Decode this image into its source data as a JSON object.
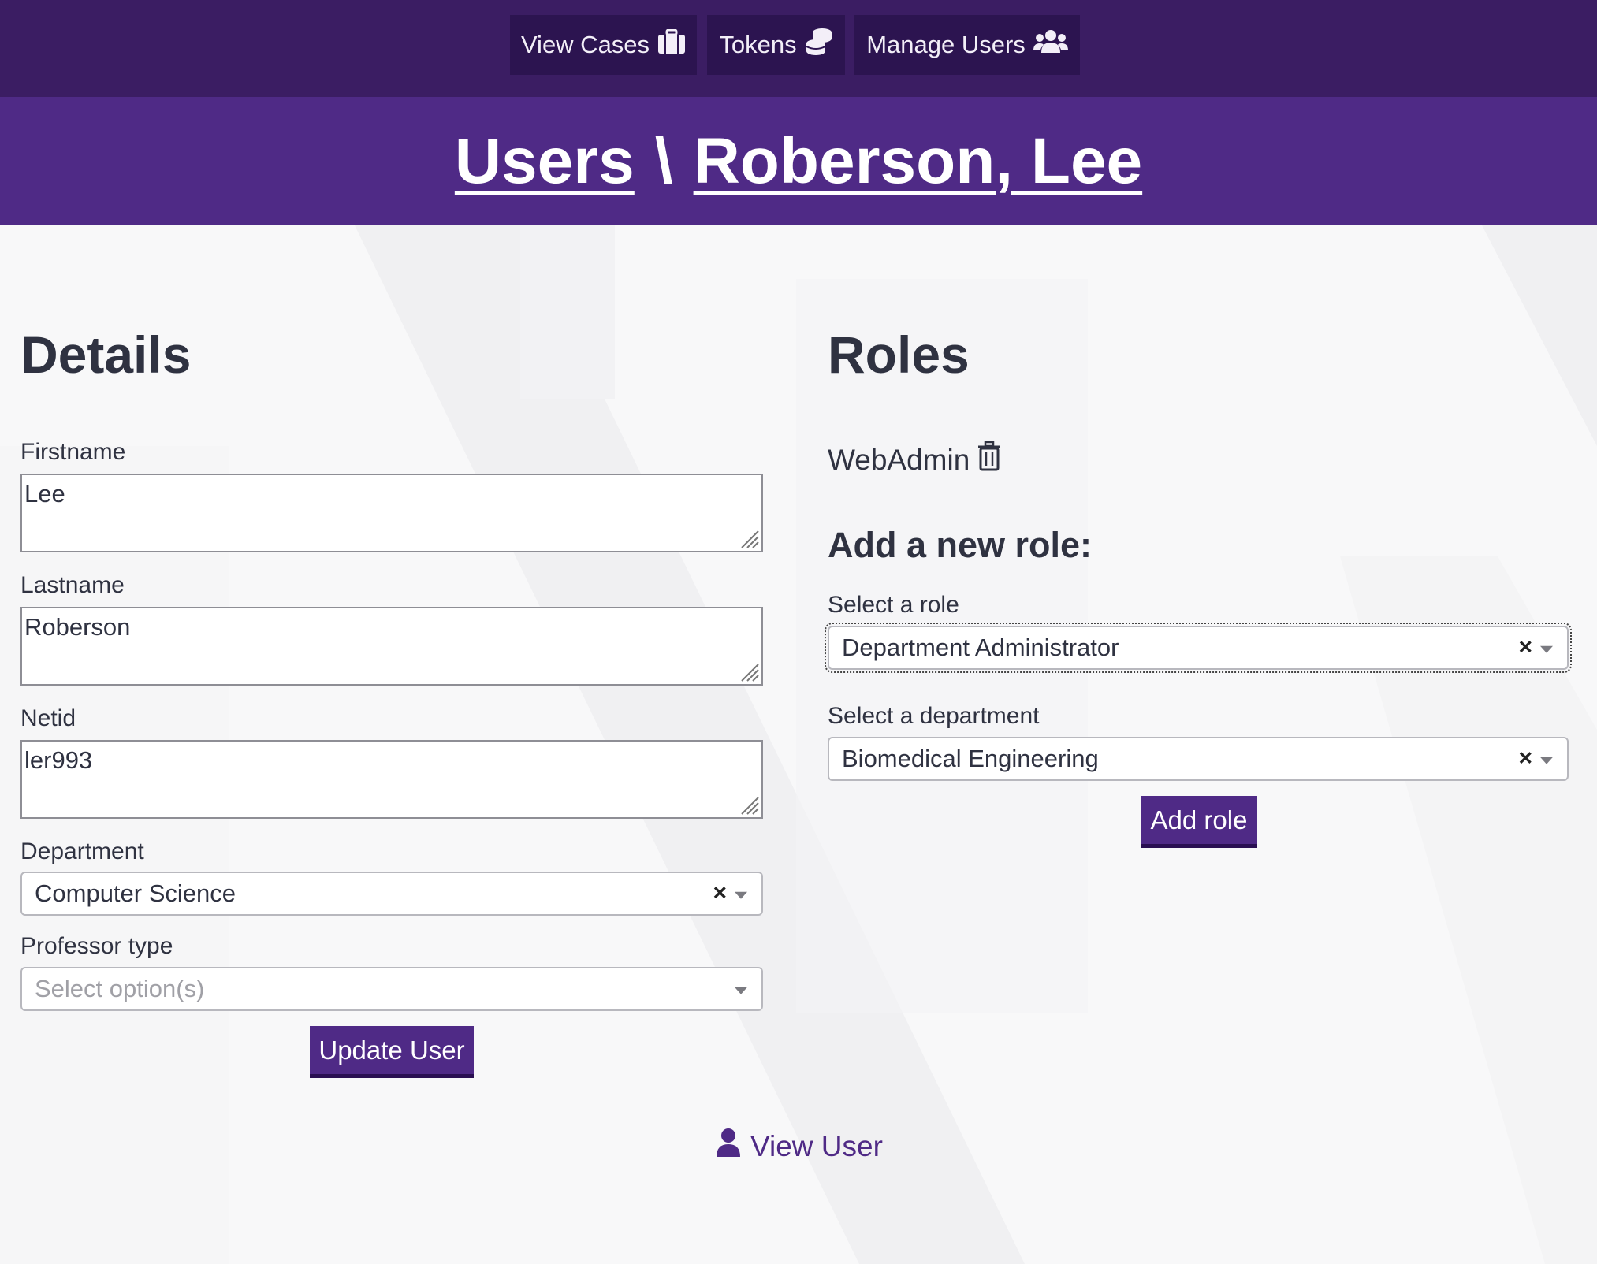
{
  "nav": {
    "view_cases": "View Cases",
    "tokens": "Tokens",
    "manage_users": "Manage Users"
  },
  "title": {
    "crumb_users": "Users",
    "separator": "\\",
    "crumb_user": "Roberson, Lee"
  },
  "details": {
    "heading": "Details",
    "firstname_label": "Firstname",
    "firstname_value": "Lee",
    "lastname_label": "Lastname",
    "lastname_value": "Roberson",
    "netid_label": "Netid",
    "netid_value": "ler993",
    "department_label": "Department",
    "department_value": "Computer Science",
    "professor_type_label": "Professor type",
    "professor_type_placeholder": "Select option(s)",
    "update_button": "Update User"
  },
  "roles": {
    "heading": "Roles",
    "items": [
      {
        "label": "WebAdmin",
        "icon": "trash-icon"
      }
    ],
    "add_heading": "Add a new role:",
    "select_role_label": "Select a role",
    "select_role_value": "Department Administrator",
    "select_department_label": "Select a department",
    "select_department_value": "Biomedical Engineering",
    "add_button": "Add role",
    "clear_symbol": "×"
  },
  "footer": {
    "view_user": "View User"
  },
  "colors": {
    "nav_bg": "#3b1d63",
    "nav_button_bg": "#2c1450",
    "title_bg": "#4f2a86",
    "primary": "#4f2a86",
    "text": "#2f3241"
  }
}
